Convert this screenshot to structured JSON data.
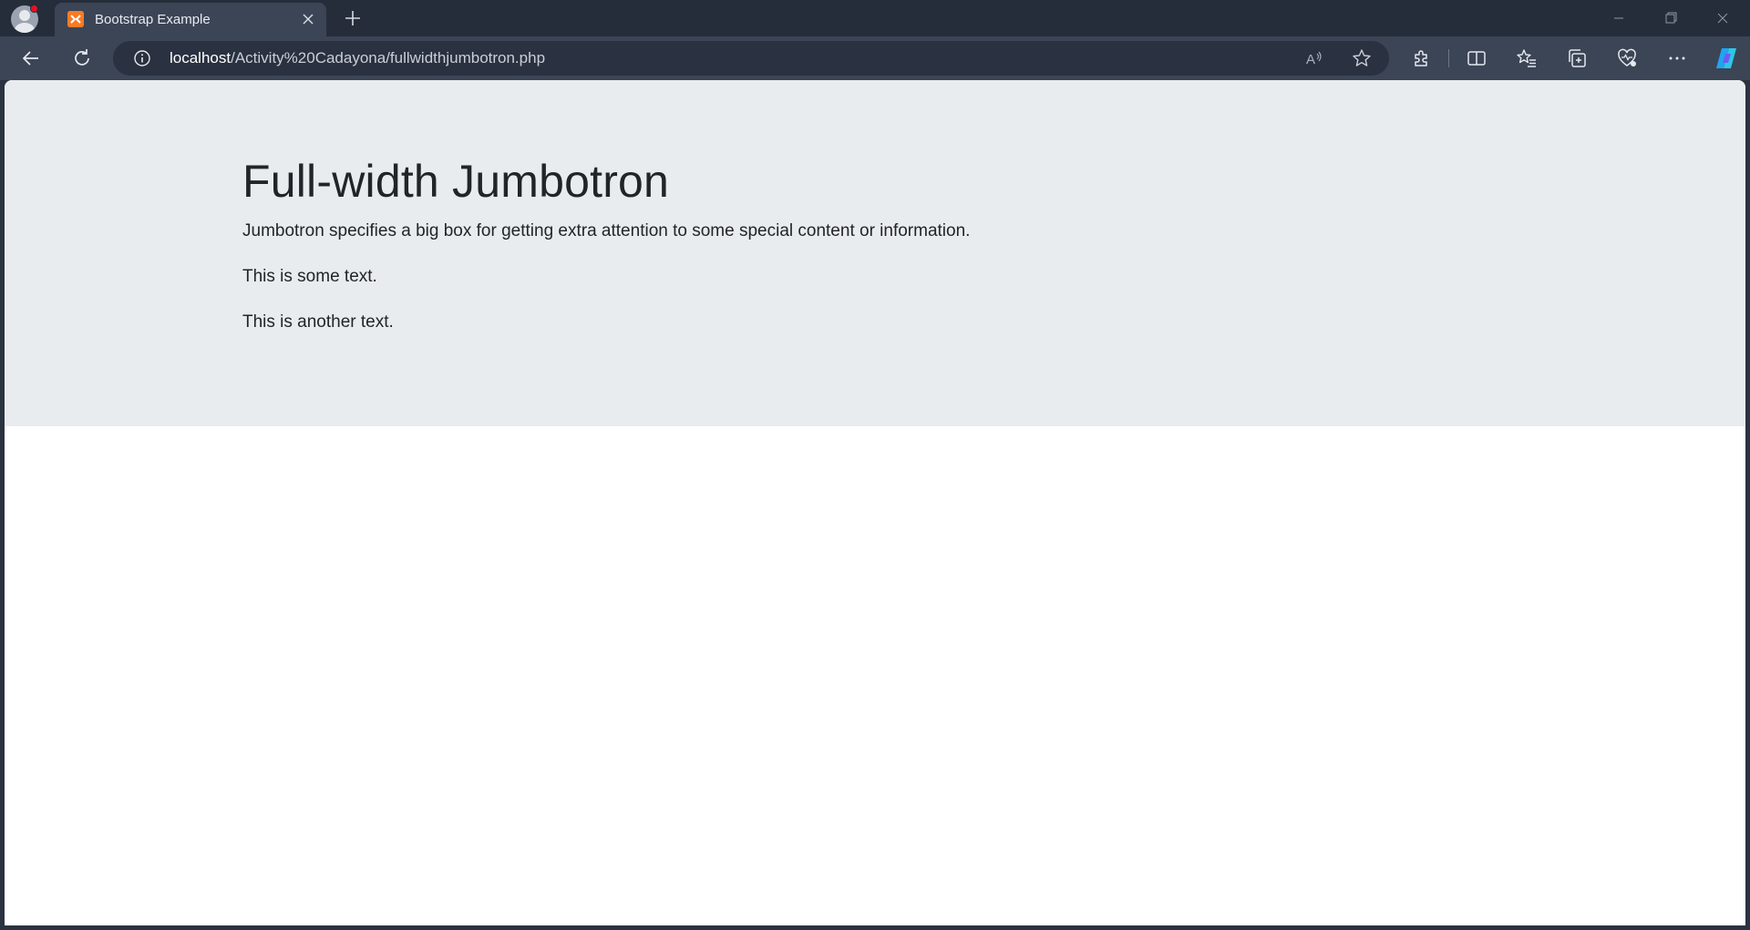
{
  "browser": {
    "tab": {
      "favicon_text": "",
      "title": "Bootstrap Example"
    },
    "address": {
      "host": "localhost",
      "path": "/Activity%20Cadayona/fullwidthjumbotron.php"
    },
    "colors": {
      "titlebar": "#262d3a",
      "toolbar": "#3b4556",
      "favicon": "#fb7a24"
    },
    "icons": [
      "profile-icon",
      "close-icon",
      "plus-icon",
      "back-arrow-icon",
      "refresh-icon",
      "info-icon",
      "read-aloud-icon",
      "favorite-star-icon",
      "extensions-icon",
      "split-screen-icon",
      "favorites-icon",
      "collections-icon",
      "browser-essentials-icon",
      "more-icon",
      "copilot-icon",
      "minimize-icon",
      "restore-icon",
      "window-close-icon"
    ]
  },
  "page": {
    "jumbotron": {
      "title": "Full-width Jumbotron",
      "lead": "Jumbotron specifies a big box for getting extra attention to some special content or information.",
      "paragraph1": "This is some text.",
      "paragraph2": "This is another text."
    },
    "colors": {
      "jumbotron_bg": "#e9ecef",
      "text": "#212529"
    }
  }
}
